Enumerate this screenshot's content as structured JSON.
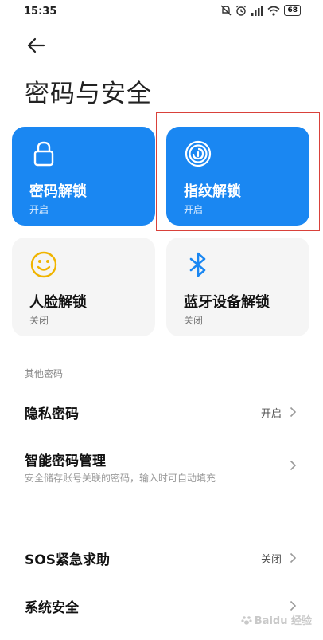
{
  "status": {
    "time": "15:35",
    "battery": "68"
  },
  "page": {
    "title": "密码与安全"
  },
  "tiles": [
    {
      "label": "密码解锁",
      "status": "开启"
    },
    {
      "label": "指纹解锁",
      "status": "开启"
    },
    {
      "label": "人脸解锁",
      "status": "关闭"
    },
    {
      "label": "蓝牙设备解锁",
      "status": "关闭"
    }
  ],
  "section": {
    "label": "其他密码"
  },
  "rows": {
    "privacy": {
      "label": "隐私密码",
      "value": "开启"
    },
    "smart": {
      "label": "智能密码管理",
      "subtitle": "安全储存账号关联的密码，输入时可自动填充"
    },
    "sos": {
      "label": "SOS紧急求助",
      "value": "关闭"
    },
    "system": {
      "label": "系统安全"
    }
  },
  "watermark": {
    "text": "Baidu 经验"
  },
  "colors": {
    "accent": "#1a87f2",
    "highlight": "#d9413a",
    "face_icon": "#f0b400"
  }
}
